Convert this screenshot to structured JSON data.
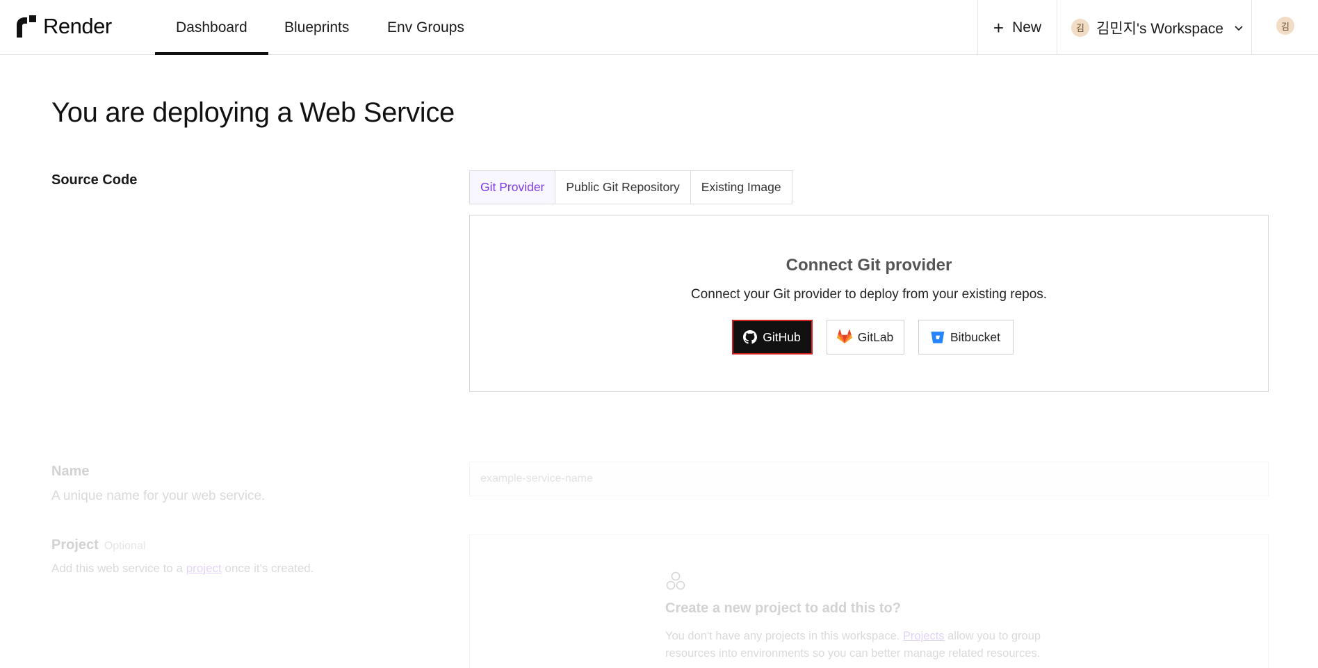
{
  "nav": {
    "brand": "Render",
    "tabs": [
      {
        "label": "Dashboard",
        "active": true
      },
      {
        "label": "Blueprints",
        "active": false
      },
      {
        "label": "Env Groups",
        "active": false
      }
    ],
    "new_label": "New",
    "workspace_label": "김민지's Workspace",
    "avatar_initial": "김"
  },
  "page": {
    "title": "You are deploying a Web Service"
  },
  "source_code": {
    "label": "Source Code",
    "tabs": [
      {
        "label": "Git Provider",
        "active": true
      },
      {
        "label": "Public Git Repository",
        "active": false
      },
      {
        "label": "Existing Image",
        "active": false
      }
    ],
    "connect": {
      "title": "Connect Git provider",
      "subtitle": "Connect your Git provider to deploy from your existing repos.",
      "providers": [
        {
          "label": "GitHub",
          "icon": "github-icon"
        },
        {
          "label": "GitLab",
          "icon": "gitlab-icon"
        },
        {
          "label": "Bitbucket",
          "icon": "bitbucket-icon"
        }
      ]
    }
  },
  "name_field": {
    "label": "Name",
    "description": "A unique name for your web service.",
    "placeholder": "example-service-name"
  },
  "project": {
    "label": "Project",
    "optional": "Optional",
    "desc_prefix": "Add this web service to a",
    "desc_link": "project",
    "desc_suffix": "once it's created.",
    "empty_title": "Create a new project to add this to?",
    "empty_prefix": "You don't have any projects in this workspace.",
    "empty_link": "Projects",
    "empty_suffix": "allow you to group resources into environments so you can better manage related resources."
  },
  "colors": {
    "accent": "#7c3aed",
    "github_bg": "#111111",
    "highlight_border": "#d21f1f"
  }
}
